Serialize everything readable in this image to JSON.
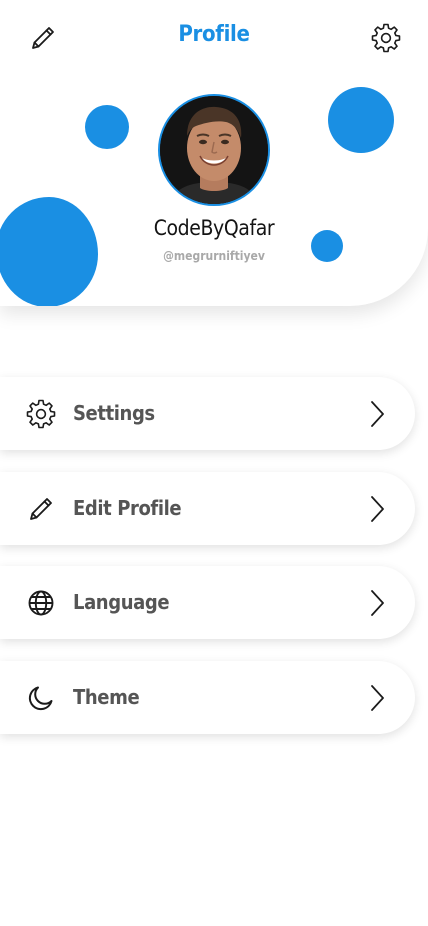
{
  "header": {
    "title": "Profile",
    "left_icon": "pencil-icon",
    "right_icon": "gear-icon"
  },
  "profile": {
    "name": "CodeByQafar",
    "handle": "@megrurniftiyev"
  },
  "menu": [
    {
      "label": "Settings",
      "icon": "gear-icon"
    },
    {
      "label": "Edit Profile",
      "icon": "pencil-icon"
    },
    {
      "label": "Language",
      "icon": "globe-icon"
    },
    {
      "label": "Theme",
      "icon": "moon-icon"
    }
  ],
  "colors": {
    "accent": "#1a8fe3",
    "label": "#555555",
    "name": "#141414",
    "handle": "#a9a9a9"
  }
}
